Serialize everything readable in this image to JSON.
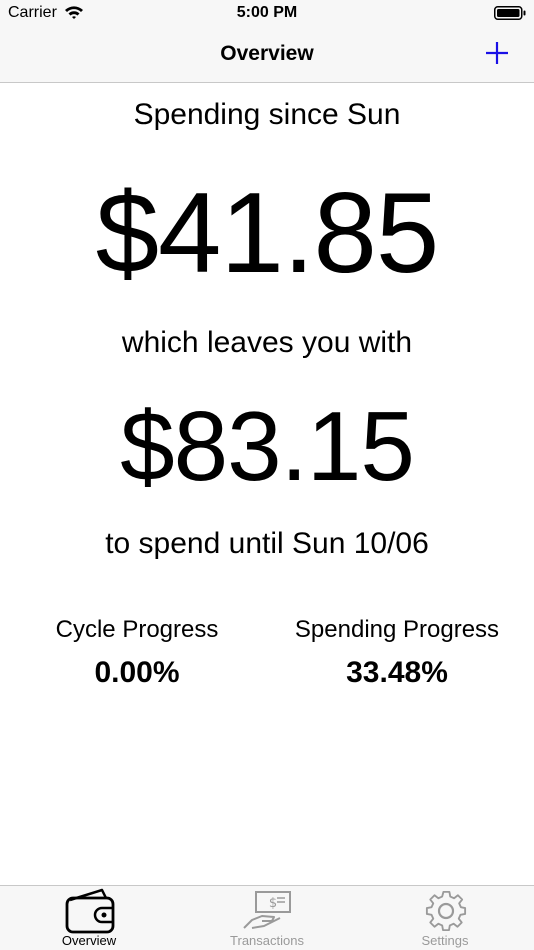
{
  "status_bar": {
    "carrier": "Carrier",
    "time": "5:00 PM"
  },
  "nav": {
    "title": "Overview",
    "add_icon": "plus-icon",
    "accent_color": "#1a10e6"
  },
  "overview": {
    "spending_since_label": "Spending since Sun",
    "spent_amount": "$41.85",
    "leaves_label": "which leaves you with",
    "remaining_amount": "$83.15",
    "until_label": "to spend until Sun 10/06"
  },
  "stats": {
    "cycle_progress_label": "Cycle Progress",
    "cycle_progress_value": "0.00%",
    "spending_progress_label": "Spending Progress",
    "spending_progress_value": "33.48%"
  },
  "tabs": [
    {
      "label": "Overview",
      "icon": "wallet-icon",
      "active": true
    },
    {
      "label": "Transactions",
      "icon": "money-hand-icon",
      "active": false
    },
    {
      "label": "Settings",
      "icon": "gear-icon",
      "active": false
    }
  ]
}
